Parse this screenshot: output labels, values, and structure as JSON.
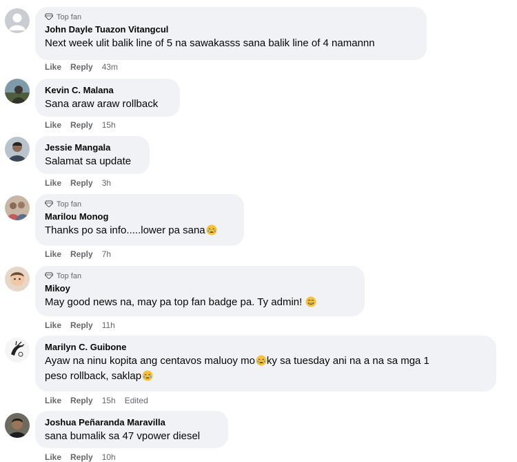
{
  "labels": {
    "like": "Like",
    "reply": "Reply",
    "top_fan": "Top fan"
  },
  "comments": [
    {
      "author": "John Dayle Tuazon Vitangcul",
      "top_fan": true,
      "text": "Next week ulit balik line of 5 na sawakasss sana balik line of 4 namannn",
      "time": "43m",
      "edited": "",
      "avatar_color": "#c7cbd1"
    },
    {
      "author": "Kevin C. Malana",
      "top_fan": false,
      "text": "Sana araw araw rollback",
      "time": "15h",
      "edited": "",
      "avatar_color": "#5b6b4a"
    },
    {
      "author": "Jessie Mangala",
      "top_fan": false,
      "text": "Salamat sa update",
      "time": "3h",
      "edited": "",
      "avatar_color": "#6c7a89"
    },
    {
      "author": "Marilou Monog",
      "top_fan": true,
      "text": "Thanks po sa info.....lower pa sana",
      "emoji": "crying-face",
      "time": "7h",
      "edited": "",
      "avatar_color": "#8a6f62"
    },
    {
      "author": "Mikoy",
      "top_fan": true,
      "text": "May good news na, may pa top fan badge pa. Ty admin!",
      "emoji": "laughing-face",
      "time": "11h",
      "edited": "",
      "avatar_color": "#d8c4b0"
    },
    {
      "author": "Marilyn C. Guibone",
      "top_fan": false,
      "text_part1": "Ayaw na ninu kopita ang centavos maluoy mo",
      "text_part2": "ky sa tuesday ani na a na sa mga 1",
      "text_line2": "peso rollback, saklap",
      "time": "15h",
      "edited": "Edited",
      "avatar_color": "#f4f4f4"
    },
    {
      "author": "Joshua Peñaranda Maravilla",
      "top_fan": false,
      "text": "sana bumalik sa 47 vpower diesel",
      "time": "10h",
      "edited": "",
      "avatar_color": "#4a3a2e"
    }
  ],
  "colors": {
    "bubble": "#f0f2f5",
    "secondary_text": "#65676b",
    "emoji_yellow": "#f7c23b"
  }
}
